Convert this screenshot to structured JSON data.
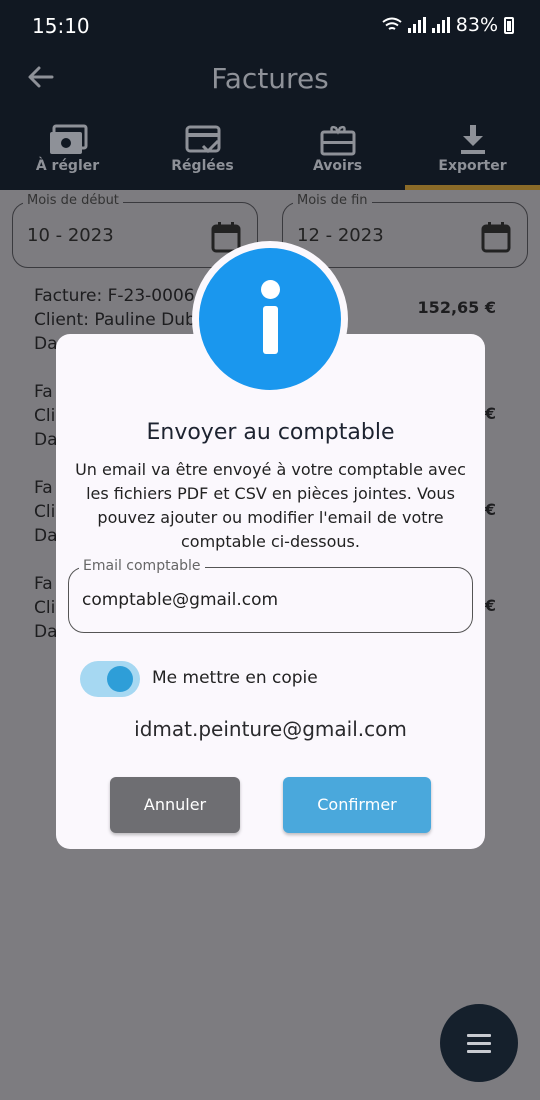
{
  "status": {
    "time": "15:10",
    "battery": "83%"
  },
  "appbar": {
    "title": "Factures"
  },
  "tabs": [
    {
      "label": "À régler",
      "icon": "money-icon"
    },
    {
      "label": "Réglées",
      "icon": "card-check-icon"
    },
    {
      "label": "Avoirs",
      "icon": "gift-card-icon"
    },
    {
      "label": "Exporter",
      "icon": "download-icon",
      "active": true
    }
  ],
  "filters": {
    "start": {
      "label": "Mois de début",
      "value": "10 - 2023"
    },
    "end": {
      "label": "Mois de fin",
      "value": "12 - 2023"
    }
  },
  "invoices": [
    {
      "line1": "Facture: F-23-0006",
      "line2": "Client: Pauline Dub",
      "line3": "Da",
      "amount": "152,65 €"
    },
    {
      "line1": "Fa",
      "line2": "Cli",
      "line3": "Da",
      "amount": "€"
    },
    {
      "line1": "Fa",
      "line2": "Cli",
      "line3": "Da",
      "amount": "€"
    },
    {
      "line1": "Fa",
      "line2": "Cli",
      "line3": "Da",
      "amount": "€"
    }
  ],
  "dialog": {
    "title": "Envoyer au comptable",
    "text": "Un email va être envoyé à votre comptable avec les fichiers PDF et CSV en pièces jointes. Vous pouvez ajouter ou modifier l'email de votre comptable ci-dessous.",
    "email_label": "Email comptable",
    "email_value": "comptable@gmail.com",
    "copy_label": "Me mettre en copie",
    "copy_enabled": true,
    "self_email": "idmat.peinture@gmail.com",
    "cancel": "Annuler",
    "confirm": "Confirmer"
  },
  "colors": {
    "accent": "#1a97ee",
    "confirm": "#4aa8dc",
    "navy": "#111822"
  }
}
